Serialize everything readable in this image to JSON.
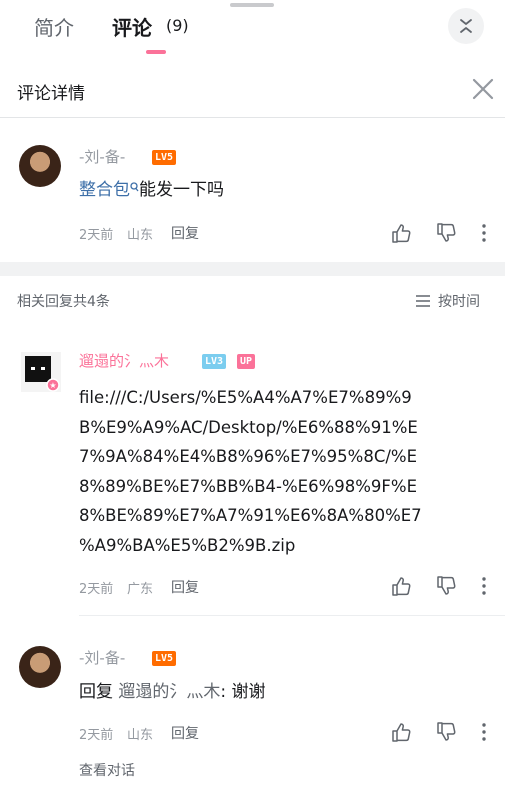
{
  "tabs": {
    "intro": "简介",
    "comments": "评论",
    "comments_count": "(9)"
  },
  "detail": {
    "title": "评论详情"
  },
  "main_comment": {
    "username": "-刘-备-",
    "level": "LV5",
    "text_link": "整合包",
    "text_rest": "能发一下吗",
    "time": "2天前",
    "location": "山东",
    "reply_label": "回复"
  },
  "related": {
    "label": "相关回复共4条",
    "sort_label": "按时间"
  },
  "reply1": {
    "username": "遛遢的氵灬木",
    "level": "LV3",
    "badge": "UP",
    "text": "file:///C:/Users/%E5%A4%A7%E7%89%9B%E9%A9%AC/Desktop/%E6%88%91%E7%9A%84%E4%B8%96%E7%95%8C/%E8%89%BE%E7%BB%B4-%E6%98%9F%E8%BE%89%E7%A7%91%E6%8A%80%E7%A9%BA%E5%B2%9B.zip",
    "lines": [
      "file:///C:/Users/%E5%A4%A7%E7%89%9",
      "B%E9%A9%AC/Desktop/%E6%88%91%E",
      "7%9A%84%E4%B8%96%E7%95%8C/%E",
      "8%89%BE%E7%BB%B4-%E6%98%9F%E",
      "8%BE%89%E7%A7%91%E6%8A%80%E7",
      "%A9%BA%E5%B2%9B.zip"
    ],
    "time": "2天前",
    "location": "广东",
    "reply_label": "回复"
  },
  "reply2": {
    "username": "-刘-备-",
    "level": "LV5",
    "prefix": "回复",
    "target": "遛遢的氵灬木",
    "text": ": 谢谢",
    "time": "2天前",
    "location": "山东",
    "reply_label": "回复",
    "view_conversation": "查看对话"
  },
  "icons": [
    "collapse-icon",
    "close-icon",
    "thumbs-up-icon",
    "thumbs-down-icon",
    "more-vertical-icon",
    "sort-list-icon"
  ]
}
